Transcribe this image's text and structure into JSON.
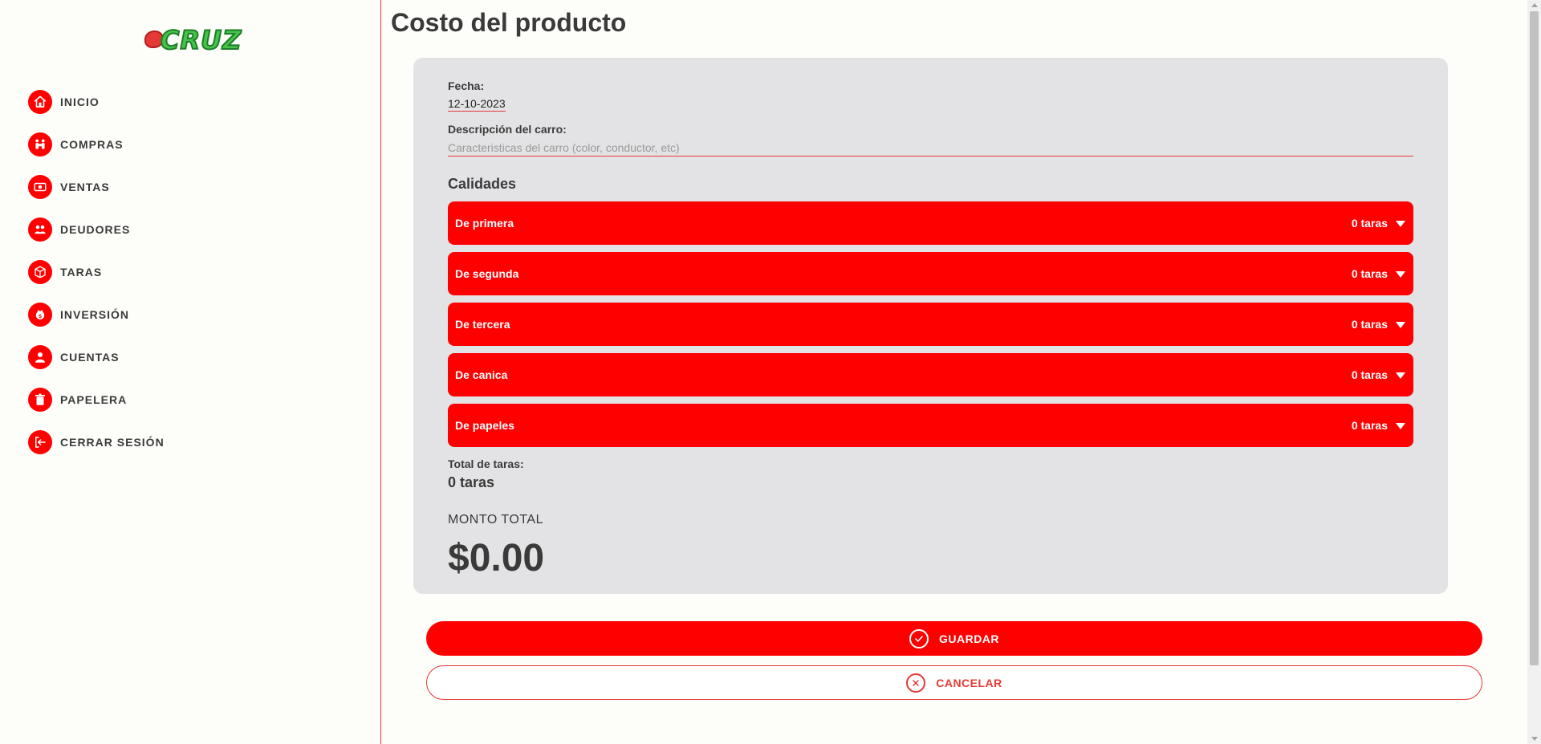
{
  "brand": {
    "logo_text": "CRUZ",
    "accent": "#ff0000",
    "logo_green": "#46c34a"
  },
  "sidebar": {
    "items": [
      {
        "label": "INICIO",
        "icon": "home-icon"
      },
      {
        "label": "COMPRAS",
        "icon": "people-icon"
      },
      {
        "label": "VENTAS",
        "icon": "money-icon"
      },
      {
        "label": "DEUDORES",
        "icon": "debtors-icon"
      },
      {
        "label": "TARAS",
        "icon": "box-icon"
      },
      {
        "label": "INVERSIÓN",
        "icon": "coin-icon"
      },
      {
        "label": "CUENTAS",
        "icon": "user-icon"
      },
      {
        "label": "PAPELERA",
        "icon": "trash-icon"
      },
      {
        "label": "CERRAR SESIÓN",
        "icon": "logout-icon"
      }
    ]
  },
  "page": {
    "title": "Costo del producto"
  },
  "form": {
    "date_label": "Fecha:",
    "date_value": "12-10-2023",
    "desc_label": "Descripción del carro:",
    "desc_placeholder": "Caracteristicas del carro (color, conductor, etc)",
    "desc_value": "",
    "qualities_title": "Calidades",
    "qualities": [
      {
        "label": "De primera",
        "count": "0 taras"
      },
      {
        "label": "De segunda",
        "count": "0 taras"
      },
      {
        "label": "De tercera",
        "count": "0 taras"
      },
      {
        "label": "De canica",
        "count": "0 taras"
      },
      {
        "label": "De papeles",
        "count": "0 taras"
      }
    ],
    "total_label": "Total de taras:",
    "total_value": "0 taras",
    "monto_label": "MONTO TOTAL",
    "monto_value": "$0.00"
  },
  "actions": {
    "save_label": "GUARDAR",
    "cancel_label": "CANCELAR"
  }
}
